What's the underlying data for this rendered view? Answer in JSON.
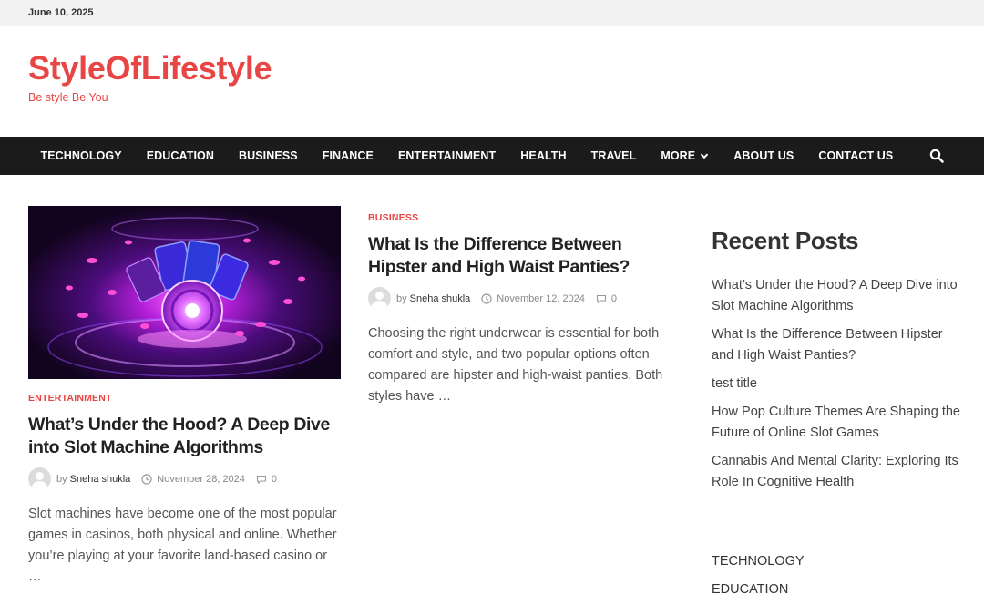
{
  "topbar": {
    "date": "June 10, 2025"
  },
  "site": {
    "title": "StyleOfLifestyle",
    "tagline": "Be style Be You"
  },
  "nav": {
    "items": [
      "TECHNOLOGY",
      "EDUCATION",
      "BUSINESS",
      "FINANCE",
      "ENTERTAINMENT",
      "HEALTH",
      "TRAVEL",
      "MORE",
      "ABOUT US",
      "CONTACT US"
    ],
    "search_icon": "search-icon"
  },
  "posts": [
    {
      "category": "ENTERTAINMENT",
      "title": "What’s Under the Hood? A Deep Dive into Slot Machine Algorithms",
      "by": "by",
      "author": "Sneha shukla",
      "date": "November 28, 2024",
      "comments": "0",
      "excerpt": "Slot machines have become one of the most popular games in casinos, both physical and online. Whether you’re playing at your favorite land-based casino or …"
    },
    {
      "category": "BUSINESS",
      "title": "What Is the Difference Between Hipster and High Waist Panties?",
      "by": "by",
      "author": "Sneha shukla",
      "date": "November 12, 2024",
      "comments": "0",
      "excerpt": "Choosing the right underwear is essential for both comfort and style, and two popular options often compared are hipster and high-waist panties. Both styles have …"
    }
  ],
  "sidebar": {
    "recent_title": "Recent Posts",
    "recent": [
      "What’s Under the Hood? A Deep Dive into Slot Machine Algorithms",
      "What Is the Difference Between Hipster and High Waist Panties?",
      "test title",
      "How Pop Culture Themes Are Shaping the Future of Online Slot Games",
      "Cannabis And Mental Clarity: Exploring Its Role In Cognitive Health"
    ],
    "categories": [
      "TECHNOLOGY",
      "EDUCATION"
    ]
  },
  "colors": {
    "accent": "#e84545",
    "nav_bg": "#1b1b1b",
    "topbar_bg": "#f2f2f2"
  }
}
